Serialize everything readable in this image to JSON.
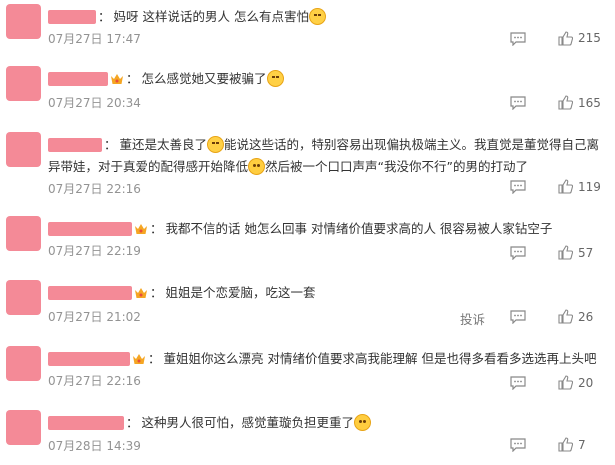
{
  "comments": [
    {
      "name_tail": "",
      "has_crown": false,
      "text_parts": [
        "妈呀 这样说话的男人 怎么有点害怕"
      ],
      "emojis": [
        "laugh"
      ],
      "time": "07月27日 17:47",
      "likes": "215",
      "report": ""
    },
    {
      "name_tail": "",
      "has_crown": true,
      "text_parts": [
        "怎么感觉她又要被骗了"
      ],
      "emojis": [
        "laugh"
      ],
      "time": "07月27日 20:34",
      "likes": "165",
      "report": ""
    },
    {
      "name_tail": "",
      "has_crown": false,
      "text_parts": [
        "董还是太善良了",
        "能说这些话的，特别容易出现偏执极端主义。我直觉是董觉得自己离异带娃，对于真爱的配得感开始降低",
        "然后被一个口口声声“我没你不行”的男的打动了"
      ],
      "emojis": [
        "laugh",
        "cry"
      ],
      "time": "07月27日 22:16",
      "likes": "119",
      "report": ""
    },
    {
      "name_tail": "",
      "has_crown": true,
      "text_parts": [
        "我都不信的话 她怎么回事 对情绪价值要求高的人 很容易被人家钻空子"
      ],
      "emojis": [],
      "time": "07月27日 22:19",
      "likes": "57",
      "report": ""
    },
    {
      "name_tail": "",
      "has_crown": true,
      "text_parts": [
        "姐姐是个恋爱脑，吃这一套"
      ],
      "emojis": [],
      "time": "07月27日 21:02",
      "likes": "26",
      "report": "投诉"
    },
    {
      "name_tail": "",
      "has_crown": true,
      "text_parts": [
        "董姐姐你这么漂亮 对情绪价值要求高我能理解 但是也得多看看多选选再上头吧"
      ],
      "emojis": [],
      "time": "07月27日 22:16",
      "likes": "20",
      "report": ""
    },
    {
      "name_tail": "",
      "has_crown": false,
      "text_parts": [
        "这种男人很可怕，感觉董璇负担更重了"
      ],
      "emojis": [
        "cry"
      ],
      "time": "07月28日 14:39",
      "likes": "7",
      "report": ""
    }
  ],
  "colors": {
    "avatar_placeholder": "#f48a97",
    "meta": "#939393"
  },
  "icons": {
    "reply": "comment-bubble-icon",
    "like": "thumbs-up-icon",
    "crown": "crown-badge-icon"
  }
}
